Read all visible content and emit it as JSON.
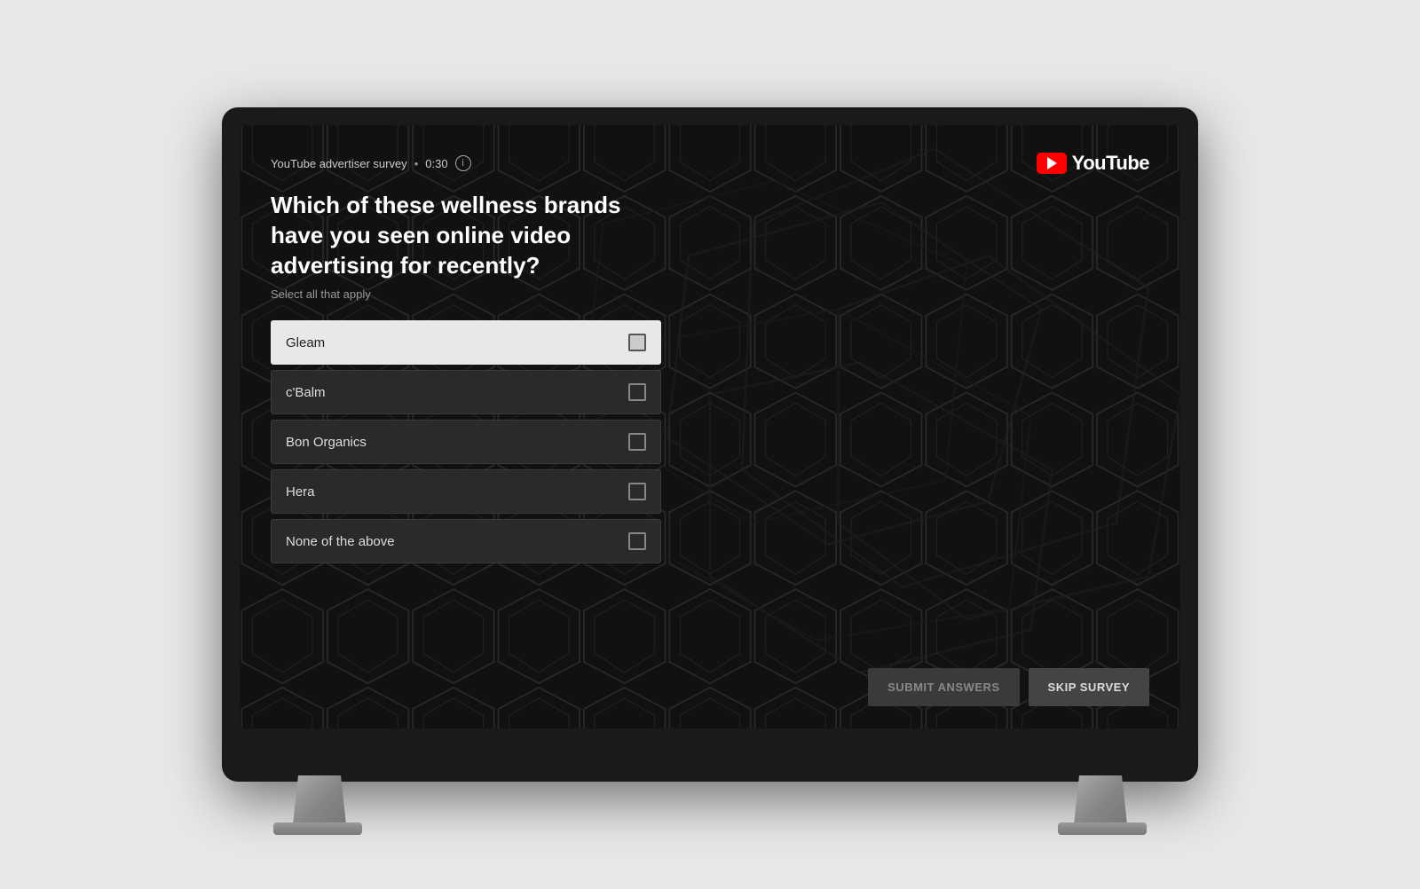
{
  "tv": {
    "screen": {
      "survey_label": "YouTube advertiser survey",
      "dot": "•",
      "timer": "0:30",
      "youtube_text": "YouTube",
      "question": "Which of these wellness brands have you seen online video advertising for recently?",
      "instruction": "Select all that apply",
      "options": [
        {
          "id": "gleam",
          "label": "Gleam",
          "selected": true
        },
        {
          "id": "cbalm",
          "label": "c'Balm",
          "selected": false
        },
        {
          "id": "bon-organics",
          "label": "Bon Organics",
          "selected": false
        },
        {
          "id": "hera",
          "label": "Hera",
          "selected": false
        },
        {
          "id": "none",
          "label": "None of the above",
          "selected": false
        }
      ],
      "submit_button": "SUBMIT ANSWERS",
      "skip_button": "SKIP SURVEY",
      "info_symbol": "i"
    }
  }
}
